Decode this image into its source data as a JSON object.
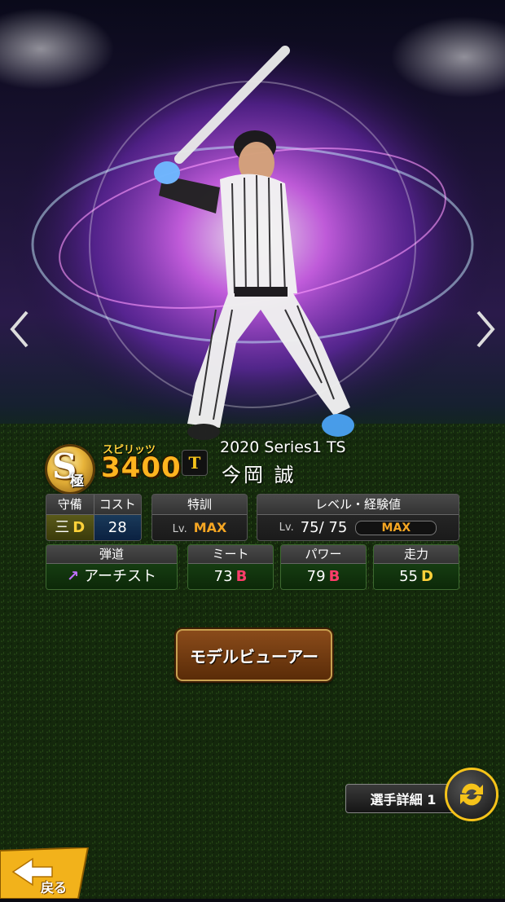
{
  "card": {
    "rank_letter": "S",
    "rank_sub": "極",
    "spirits_label": "スピリッツ",
    "spirits_value": "3400",
    "series": "2020 Series1 TS",
    "player_name": "今岡 誠",
    "team_logo_text": "T"
  },
  "stats": {
    "position": {
      "label_a": "守備",
      "label_b": "コスト",
      "position": "三",
      "grade": "D",
      "cost": "28"
    },
    "training": {
      "label": "特訓",
      "lv": "Lv.",
      "value": "MAX"
    },
    "level": {
      "label": "レベル・経験値",
      "lv": "Lv.",
      "value": "75/ 75",
      "max": "MAX"
    },
    "trajectory": {
      "label": "弾道",
      "value": "アーチスト"
    },
    "meet": {
      "label": "ミート",
      "value": "73",
      "grade": "B"
    },
    "power": {
      "label": "パワー",
      "value": "79",
      "grade": "B"
    },
    "speed": {
      "label": "走力",
      "value": "55",
      "grade": "D"
    }
  },
  "buttons": {
    "model_viewer": "モデルビューアー",
    "player_detail": "選手詳細 1",
    "back": "戻る"
  },
  "colors": {
    "accent_gold": "#f5c31a",
    "spirits_orange": "#ffb41f",
    "grade_b": "#ff3d6a",
    "grade_d": "#ffd23a"
  }
}
